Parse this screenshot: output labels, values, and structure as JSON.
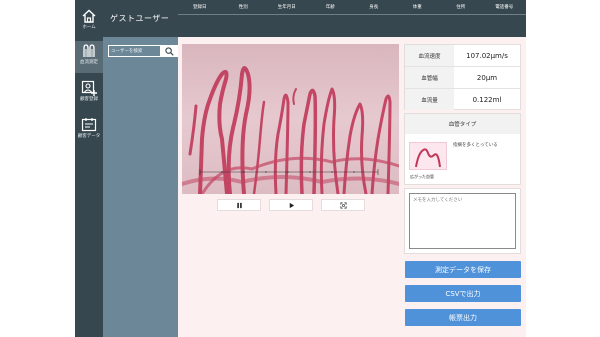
{
  "sidebar": {
    "items": [
      {
        "label": "ホーム",
        "icon": "home-icon"
      },
      {
        "label": "血流測定",
        "icon": "capillary-icon"
      },
      {
        "label": "顧客登録",
        "icon": "add-customer-icon"
      },
      {
        "label": "顧客データ",
        "icon": "customer-data-icon"
      }
    ]
  },
  "user_panel": {
    "name": "ゲストユーザー",
    "search_placeholder": "ユーザーを検索",
    "search_icon": "search-icon"
  },
  "header": {
    "columns": [
      "登録日",
      "性別",
      "生年月日",
      "年齢",
      "身長",
      "体重",
      "住所",
      "電話番号"
    ]
  },
  "player": {
    "controls": [
      {
        "name": "pause",
        "icon": "pause-icon"
      },
      {
        "name": "play",
        "icon": "play-icon"
      },
      {
        "name": "fullscreen",
        "icon": "fullscreen-icon"
      }
    ]
  },
  "measurements": [
    {
      "label": "血流速度",
      "value": "107.02μm/s"
    },
    {
      "label": "血管幅",
      "value": "20μm"
    },
    {
      "label": "血流量",
      "value": "0.122ml"
    }
  ],
  "vessel_type": {
    "title": "血管タイプ",
    "thumb_caption": "広がった血管",
    "description": "指摘を多くとっている"
  },
  "memo": {
    "placeholder": "メモを入力してください"
  },
  "actions": {
    "save": "測定データを保存",
    "csv": "CSVで出力",
    "report": "帳票出力"
  },
  "colors": {
    "rail": "#37474f",
    "panel": "#6c8797",
    "main_bg": "#fdf0f1",
    "accent": "#4f92d9",
    "vessel": "#c0395a"
  }
}
